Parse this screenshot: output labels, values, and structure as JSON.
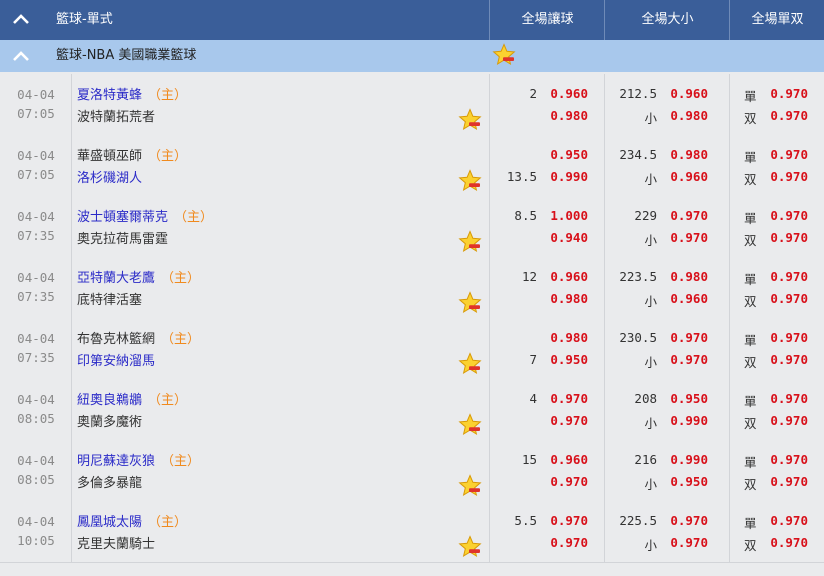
{
  "header": {
    "title": "籃球-單式",
    "col_handicap": "全場讓球",
    "col_total": "全場大小",
    "col_oddeven": "全場單双"
  },
  "league": {
    "name": "籃球-NBA 美國職業籃球"
  },
  "labels": {
    "home_tag": "（主）",
    "under": "小",
    "odd": "單",
    "even": "双"
  },
  "games": [
    {
      "date": "04-04",
      "time": "07:05",
      "home": "夏洛特黃蜂",
      "away": "波特蘭拓荒者",
      "fav": "home",
      "hcp_line": "2",
      "hcp_o1": "0.960",
      "hcp_o2": "0.980",
      "total": "212.5",
      "total_o1": "0.960",
      "total_o2": "0.980",
      "odd_o": "0.970",
      "even_o": "0.970"
    },
    {
      "date": "04-04",
      "time": "07:05",
      "home": "華盛頓巫師",
      "away": "洛杉磯湖人",
      "fav": "away",
      "hcp_line": "13.5",
      "hcp_o1": "0.950",
      "hcp_o2": "0.990",
      "total": "234.5",
      "total_o1": "0.980",
      "total_o2": "0.960",
      "odd_o": "0.970",
      "even_o": "0.970"
    },
    {
      "date": "04-04",
      "time": "07:35",
      "home": "波士頓塞爾蒂克",
      "away": "奧克拉荷馬雷霆",
      "fav": "home",
      "hcp_line": "8.5",
      "hcp_o1": "1.000",
      "hcp_o2": "0.940",
      "total": "229",
      "total_o1": "0.970",
      "total_o2": "0.970",
      "odd_o": "0.970",
      "even_o": "0.970"
    },
    {
      "date": "04-04",
      "time": "07:35",
      "home": "亞特蘭大老鷹",
      "away": "底特律活塞",
      "fav": "home",
      "hcp_line": "12",
      "hcp_o1": "0.960",
      "hcp_o2": "0.980",
      "total": "223.5",
      "total_o1": "0.980",
      "total_o2": "0.960",
      "odd_o": "0.970",
      "even_o": "0.970"
    },
    {
      "date": "04-04",
      "time": "07:35",
      "home": "布魯克林籃網",
      "away": "印第安納溜馬",
      "fav": "away",
      "hcp_line": "7",
      "hcp_o1": "0.980",
      "hcp_o2": "0.950",
      "total": "230.5",
      "total_o1": "0.970",
      "total_o2": "0.970",
      "odd_o": "0.970",
      "even_o": "0.970"
    },
    {
      "date": "04-04",
      "time": "08:05",
      "home": "紐奧良鵜鶘",
      "away": "奧蘭多魔術",
      "fav": "home",
      "hcp_line": "4",
      "hcp_o1": "0.970",
      "hcp_o2": "0.970",
      "total": "208",
      "total_o1": "0.950",
      "total_o2": "0.990",
      "odd_o": "0.970",
      "even_o": "0.970"
    },
    {
      "date": "04-04",
      "time": "08:05",
      "home": "明尼蘇達灰狼",
      "away": "多倫多暴龍",
      "fav": "home",
      "hcp_line": "15",
      "hcp_o1": "0.960",
      "hcp_o2": "0.970",
      "total": "216",
      "total_o1": "0.990",
      "total_o2": "0.950",
      "odd_o": "0.970",
      "even_o": "0.970"
    },
    {
      "date": "04-04",
      "time": "10:05",
      "home": "鳳凰城太陽",
      "away": "克里夫蘭騎士",
      "fav": "home",
      "hcp_line": "5.5",
      "hcp_o1": "0.970",
      "hcp_o2": "0.970",
      "total": "225.5",
      "total_o1": "0.970",
      "total_o2": "0.970",
      "odd_o": "0.970",
      "even_o": "0.970"
    }
  ]
}
